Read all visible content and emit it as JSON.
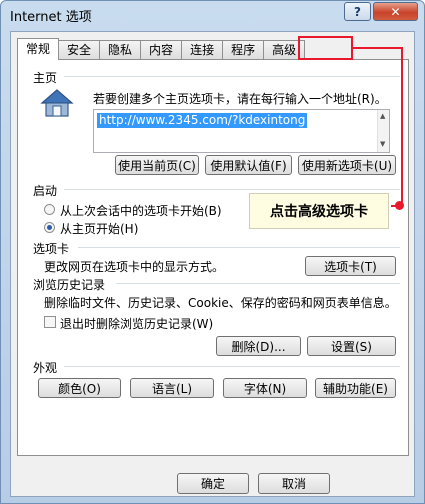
{
  "window": {
    "title": "Internet 选项",
    "help_label": "?",
    "close_label": "✕"
  },
  "tabs": [
    "常规",
    "安全",
    "隐私",
    "内容",
    "连接",
    "程序",
    "高级"
  ],
  "homepage": {
    "group_label": "主页",
    "description": "若要创建多个主页选项卡，请在每行输入一个地址(R)。",
    "url": "http://www.2345.com/?kdexintong",
    "buttons": {
      "current": "使用当前页(C)",
      "default": "使用默认值(F)",
      "new_tab": "使用新选项卡(U)"
    }
  },
  "startup": {
    "group_label": "启动",
    "options": [
      "从上次会话中的选项卡开始(B)",
      "从主页开始(H)"
    ],
    "selected_index": 1
  },
  "tabs_section": {
    "group_label": "选项卡",
    "description": "更改网页在选项卡中的显示方式。",
    "button": "选项卡(T)"
  },
  "history": {
    "group_label": "浏览历史记录",
    "description": "删除临时文件、历史记录、Cookie、保存的密码和网页表单信息。",
    "checkbox_label": "退出时删除浏览历史记录(W)",
    "buttons": {
      "delete": "删除(D)...",
      "settings": "设置(S)"
    }
  },
  "appearance": {
    "group_label": "外观",
    "buttons": [
      "颜色(O)",
      "语言(L)",
      "字体(N)",
      "辅助功能(E)"
    ]
  },
  "footer": {
    "ok": "确定",
    "cancel": "取消"
  },
  "annotation": {
    "callout_text": "点击高级选项卡",
    "highlight_color": "#e8192c"
  }
}
